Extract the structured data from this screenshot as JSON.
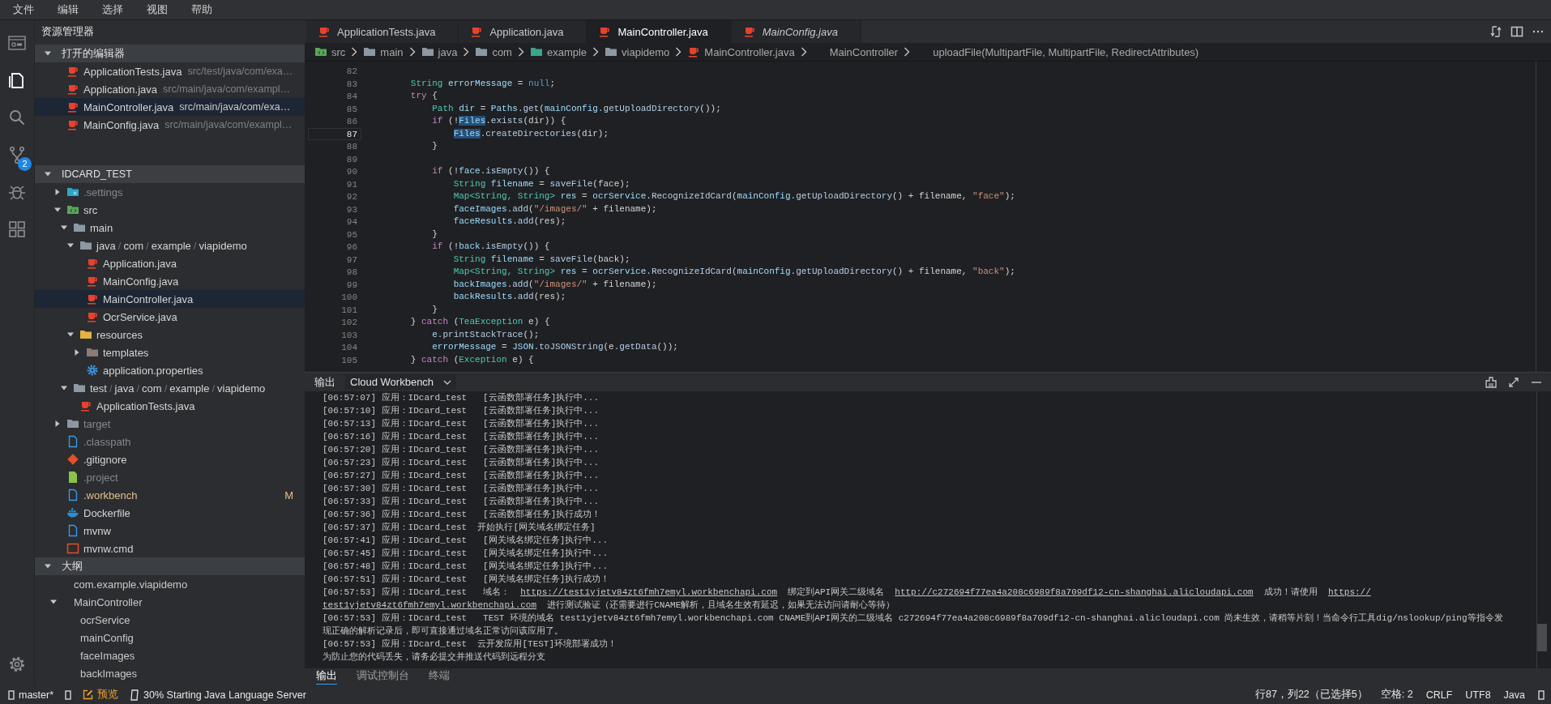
{
  "menu": [
    "文件",
    "编辑",
    "选择",
    "视图",
    "帮助"
  ],
  "activity_bar": {
    "items": [
      {
        "kind": "workbench",
        "selected": false
      },
      {
        "kind": "explorer",
        "selected": true
      },
      {
        "kind": "search",
        "selected": false
      },
      {
        "kind": "source-control",
        "selected": false,
        "badge": "2"
      },
      {
        "kind": "debug",
        "selected": false
      },
      {
        "kind": "extensions",
        "selected": false
      }
    ]
  },
  "sidebar": {
    "title": "资源管理器",
    "open_editors": {
      "title": "打开的编辑器",
      "expanded": true,
      "items": [
        {
          "name": "ApplicationTests.java",
          "path": "src/test/java/com/exa…",
          "selected": false
        },
        {
          "name": "Application.java",
          "path": "src/main/java/com/exampl…",
          "selected": false
        },
        {
          "name": "MainController.java",
          "path": "src/main/java/com/exa…",
          "selected": true
        },
        {
          "name": "MainConfig.java",
          "path": "src/main/java/com/exampl…",
          "selected": false
        }
      ]
    },
    "project": {
      "title": "IDCARD_TEST",
      "expanded": true,
      "tree": [
        {
          "name": ".settings",
          "kind": "folder-settings",
          "expanded": false,
          "selected": false,
          "ignored": true,
          "modified": false
        },
        {
          "name": "src",
          "kind": "folder-src",
          "expanded": true,
          "selected": false,
          "ignored": false,
          "modified": false,
          "children": [
            {
              "name": "main",
              "kind": "folder",
              "expanded": true,
              "selected": false,
              "ignored": false,
              "modified": false,
              "children": [
                {
                  "segments": [
                    "java",
                    "com",
                    "example",
                    "viapidemo"
                  ],
                  "separator": "/",
                  "kind": "folder",
                  "expanded": true,
                  "selected": false,
                  "ignored": false,
                  "modified": false,
                  "children": [
                    {
                      "name": "Application.java",
                      "kind": "java",
                      "selected": false,
                      "ignored": false,
                      "modified": false
                    },
                    {
                      "name": "MainConfig.java",
                      "kind": "java",
                      "selected": false,
                      "ignored": false,
                      "modified": false
                    },
                    {
                      "name": "MainController.java",
                      "kind": "java",
                      "selected": true,
                      "ignored": false,
                      "modified": false
                    },
                    {
                      "name": "OcrService.java",
                      "kind": "java",
                      "selected": false,
                      "ignored": false,
                      "modified": false
                    }
                  ]
                },
                {
                  "name": "resources",
                  "kind": "folder-resources",
                  "expanded": true,
                  "selected": false,
                  "ignored": false,
                  "modified": false,
                  "children": [
                    {
                      "name": "templates",
                      "kind": "folder-templates",
                      "expanded": false,
                      "selected": false,
                      "ignored": false,
                      "modified": false
                    },
                    {
                      "name": "application.properties",
                      "kind": "properties",
                      "selected": false,
                      "ignored": false,
                      "modified": false
                    }
                  ]
                }
              ]
            },
            {
              "segments": [
                "test",
                "java",
                "com",
                "example",
                "viapidemo"
              ],
              "separator": "/",
              "kind": "folder",
              "expanded": true,
              "selected": false,
              "ignored": false,
              "modified": false,
              "children": [
                {
                  "name": "ApplicationTests.java",
                  "kind": "java",
                  "selected": false,
                  "ignored": false,
                  "modified": false
                }
              ]
            }
          ]
        },
        {
          "name": "target",
          "kind": "folder",
          "expanded": false,
          "selected": false,
          "ignored": true,
          "modified": false
        },
        {
          "name": ".classpath",
          "kind": "file",
          "selected": false,
          "ignored": true,
          "modified": false
        },
        {
          "name": ".gitignore",
          "kind": "git",
          "selected": false,
          "ignored": false,
          "modified": false
        },
        {
          "name": ".project",
          "kind": "project",
          "selected": false,
          "ignored": true,
          "modified": false
        },
        {
          "name": ".workbench",
          "kind": "file",
          "selected": false,
          "ignored": false,
          "modified": true,
          "badge": "M"
        },
        {
          "name": "Dockerfile",
          "kind": "docker",
          "selected": false,
          "ignored": false,
          "modified": false
        },
        {
          "name": "mvnw",
          "kind": "file",
          "selected": false,
          "ignored": false,
          "modified": false
        },
        {
          "name": "mvnw.cmd",
          "kind": "cmd",
          "selected": false,
          "ignored": false,
          "modified": false
        }
      ]
    },
    "outline": {
      "title": "大纲",
      "expanded": true,
      "items": [
        {
          "name": "com.example.viapidemo"
        },
        {
          "name": "MainController",
          "expanded": true,
          "children": [
            {
              "name": "ocrService"
            },
            {
              "name": "mainConfig"
            },
            {
              "name": "faceImages"
            },
            {
              "name": "backImages"
            }
          ]
        }
      ]
    }
  },
  "editor": {
    "tabs": [
      {
        "label": "ApplicationTests.java",
        "selected": false,
        "preview": false
      },
      {
        "label": "Application.java",
        "selected": false,
        "preview": false
      },
      {
        "label": "MainController.java",
        "selected": true,
        "preview": false
      },
      {
        "label": "MainConfig.java",
        "selected": false,
        "preview": true
      }
    ],
    "breadcrumb": [
      {
        "label": "src",
        "kind": "folder-src"
      },
      {
        "label": "main",
        "kind": "folder"
      },
      {
        "label": "java",
        "kind": "folder"
      },
      {
        "label": "com",
        "kind": "folder"
      },
      {
        "label": "example",
        "kind": "package"
      },
      {
        "label": "viapidemo",
        "kind": "folder"
      },
      {
        "label": "MainController.java",
        "kind": "java"
      },
      {
        "label": "MainController",
        "kind": "none"
      },
      {
        "label": "uploadFile(MultipartFile, MultipartFile, RedirectAttributes)",
        "kind": "none"
      }
    ],
    "lines": [
      {
        "number": "82",
        "current": false
      },
      {
        "number": "83",
        "current": false,
        "tokens": [
          {
            "text": "        String",
            "kind": "ty"
          },
          {
            "text": " errorMessage",
            "kind": "v"
          },
          {
            "text": " = ",
            "kind": "p"
          },
          {
            "text": "null",
            "kind": "c"
          },
          {
            "text": ";",
            "kind": "p"
          }
        ]
      },
      {
        "number": "84",
        "current": false,
        "tokens": [
          {
            "text": "        try",
            "kind": "kw"
          },
          {
            "text": " {",
            "kind": "p"
          }
        ]
      },
      {
        "number": "85",
        "current": false,
        "tokens": [
          {
            "text": "            Path",
            "kind": "ty"
          },
          {
            "text": " dir",
            "kind": "v"
          },
          {
            "text": " = ",
            "kind": "p"
          },
          {
            "text": "Paths",
            "kind": "v"
          },
          {
            "text": ".",
            "kind": "p"
          },
          {
            "text": "get",
            "kind": "fn"
          },
          {
            "text": "(",
            "kind": "p"
          },
          {
            "text": "mainConfig",
            "kind": "v"
          },
          {
            "text": ".",
            "kind": "p"
          },
          {
            "text": "getUploadDirectory",
            "kind": "fn"
          },
          {
            "text": "());",
            "kind": "p"
          }
        ]
      },
      {
        "number": "86",
        "current": false,
        "tokens": [
          {
            "text": "            if",
            "kind": "kw"
          },
          {
            "text": " (!",
            "kind": "p"
          },
          {
            "text": "Files",
            "kind": "m"
          },
          {
            "text": ".",
            "kind": "p"
          },
          {
            "text": "exists",
            "kind": "fn"
          },
          {
            "text": "(dir)) {",
            "kind": "p"
          }
        ]
      },
      {
        "number": "87",
        "current": true,
        "tokens": [
          {
            "text": "                Files",
            "kind": "m"
          },
          {
            "text": ".",
            "kind": "p"
          },
          {
            "text": "createDirectories",
            "kind": "fn"
          },
          {
            "text": "(dir);",
            "kind": "p"
          }
        ]
      },
      {
        "number": "88",
        "current": false,
        "tokens": [
          {
            "text": "            }",
            "kind": "p"
          }
        ]
      },
      {
        "number": "89",
        "current": false
      },
      {
        "number": "90",
        "current": false,
        "tokens": [
          {
            "text": "            if",
            "kind": "kw"
          },
          {
            "text": " (!",
            "kind": "p"
          },
          {
            "text": "face",
            "kind": "v"
          },
          {
            "text": ".",
            "kind": "p"
          },
          {
            "text": "isEmpty",
            "kind": "fn"
          },
          {
            "text": "()) {",
            "kind": "p"
          }
        ]
      },
      {
        "number": "91",
        "current": false,
        "tokens": [
          {
            "text": "                String",
            "kind": "ty"
          },
          {
            "text": " filename",
            "kind": "v"
          },
          {
            "text": " = ",
            "kind": "p"
          },
          {
            "text": "saveFile",
            "kind": "fn"
          },
          {
            "text": "(face);",
            "kind": "p"
          }
        ]
      },
      {
        "number": "92",
        "current": false,
        "tokens": [
          {
            "text": "                Map<String, String>",
            "kind": "ty"
          },
          {
            "text": " res",
            "kind": "v"
          },
          {
            "text": " = ",
            "kind": "p"
          },
          {
            "text": "ocrService",
            "kind": "v"
          },
          {
            "text": ".",
            "kind": "p"
          },
          {
            "text": "RecognizeIdCard",
            "kind": "fn"
          },
          {
            "text": "(",
            "kind": "p"
          },
          {
            "text": "mainConfig",
            "kind": "v"
          },
          {
            "text": ".",
            "kind": "p"
          },
          {
            "text": "getUploadDirectory",
            "kind": "fn"
          },
          {
            "text": "() + filename, ",
            "kind": "p"
          },
          {
            "text": "\"face\"",
            "kind": "s"
          },
          {
            "text": ");",
            "kind": "p"
          }
        ]
      },
      {
        "number": "93",
        "current": false,
        "tokens": [
          {
            "text": "                faceImages",
            "kind": "v"
          },
          {
            "text": ".",
            "kind": "p"
          },
          {
            "text": "add",
            "kind": "fn"
          },
          {
            "text": "(",
            "kind": "p"
          },
          {
            "text": "\"/images/\"",
            "kind": "s"
          },
          {
            "text": " + filename);",
            "kind": "p"
          }
        ]
      },
      {
        "number": "94",
        "current": false,
        "tokens": [
          {
            "text": "                faceResults",
            "kind": "v"
          },
          {
            "text": ".",
            "kind": "p"
          },
          {
            "text": "add",
            "kind": "fn"
          },
          {
            "text": "(res);",
            "kind": "p"
          }
        ]
      },
      {
        "number": "95",
        "current": false,
        "tokens": [
          {
            "text": "            }",
            "kind": "p"
          }
        ]
      },
      {
        "number": "96",
        "current": false,
        "tokens": [
          {
            "text": "            if",
            "kind": "kw"
          },
          {
            "text": " (!",
            "kind": "p"
          },
          {
            "text": "back",
            "kind": "v"
          },
          {
            "text": ".",
            "kind": "p"
          },
          {
            "text": "isEmpty",
            "kind": "fn"
          },
          {
            "text": "()) {",
            "kind": "p"
          }
        ]
      },
      {
        "number": "97",
        "current": false,
        "tokens": [
          {
            "text": "                String",
            "kind": "ty"
          },
          {
            "text": " filename",
            "kind": "v"
          },
          {
            "text": " = ",
            "kind": "p"
          },
          {
            "text": "saveFile",
            "kind": "fn"
          },
          {
            "text": "(back);",
            "kind": "p"
          }
        ]
      },
      {
        "number": "98",
        "current": false,
        "tokens": [
          {
            "text": "                Map<String, String>",
            "kind": "ty"
          },
          {
            "text": " res",
            "kind": "v"
          },
          {
            "text": " = ",
            "kind": "p"
          },
          {
            "text": "ocrService",
            "kind": "v"
          },
          {
            "text": ".",
            "kind": "p"
          },
          {
            "text": "RecognizeIdCard",
            "kind": "fn"
          },
          {
            "text": "(",
            "kind": "p"
          },
          {
            "text": "mainConfig",
            "kind": "v"
          },
          {
            "text": ".",
            "kind": "p"
          },
          {
            "text": "getUploadDirectory",
            "kind": "fn"
          },
          {
            "text": "() + filename, ",
            "kind": "p"
          },
          {
            "text": "\"back\"",
            "kind": "s"
          },
          {
            "text": ");",
            "kind": "p"
          }
        ]
      },
      {
        "number": "99",
        "current": false,
        "tokens": [
          {
            "text": "                backImages",
            "kind": "v"
          },
          {
            "text": ".",
            "kind": "p"
          },
          {
            "text": "add",
            "kind": "fn"
          },
          {
            "text": "(",
            "kind": "p"
          },
          {
            "text": "\"/images/\"",
            "kind": "s"
          },
          {
            "text": " + filename);",
            "kind": "p"
          }
        ]
      },
      {
        "number": "100",
        "current": false,
        "tokens": [
          {
            "text": "                backResults",
            "kind": "v"
          },
          {
            "text": ".",
            "kind": "p"
          },
          {
            "text": "add",
            "kind": "fn"
          },
          {
            "text": "(res);",
            "kind": "p"
          }
        ]
      },
      {
        "number": "101",
        "current": false,
        "tokens": [
          {
            "text": "            }",
            "kind": "p"
          }
        ]
      },
      {
        "number": "102",
        "current": false,
        "tokens": [
          {
            "text": "        } ",
            "kind": "p"
          },
          {
            "text": "catch",
            "kind": "kw"
          },
          {
            "text": " (",
            "kind": "p"
          },
          {
            "text": "TeaException",
            "kind": "ty"
          },
          {
            "text": " e) {",
            "kind": "p"
          }
        ]
      },
      {
        "number": "103",
        "current": false,
        "tokens": [
          {
            "text": "            e",
            "kind": "v"
          },
          {
            "text": ".",
            "kind": "p"
          },
          {
            "text": "printStackTrace",
            "kind": "fn"
          },
          {
            "text": "();",
            "kind": "p"
          }
        ]
      },
      {
        "number": "104",
        "current": false,
        "tokens": [
          {
            "text": "            errorMessage",
            "kind": "v"
          },
          {
            "text": " = ",
            "kind": "p"
          },
          {
            "text": "JSON",
            "kind": "v"
          },
          {
            "text": ".",
            "kind": "p"
          },
          {
            "text": "toJSONString",
            "kind": "fn"
          },
          {
            "text": "(e.",
            "kind": "p"
          },
          {
            "text": "getData",
            "kind": "fn"
          },
          {
            "text": "());",
            "kind": "p"
          }
        ]
      },
      {
        "number": "105",
        "current": false,
        "tokens": [
          {
            "text": "        } ",
            "kind": "p"
          },
          {
            "text": "catch",
            "kind": "kw"
          },
          {
            "text": " (",
            "kind": "p"
          },
          {
            "text": "Exception",
            "kind": "ty"
          },
          {
            "text": " e) {",
            "kind": "p"
          }
        ]
      }
    ]
  },
  "panel": {
    "title": "输出",
    "channel": "Cloud Workbench",
    "log": [
      {
        "text": "[06:57:07] 应用：IDcard_test   [云函数部署任务]执行中..."
      },
      {
        "text": "[06:57:10] 应用：IDcard_test   [云函数部署任务]执行中..."
      },
      {
        "text": "[06:57:13] 应用：IDcard_test   [云函数部署任务]执行中..."
      },
      {
        "text": "[06:57:16] 应用：IDcard_test   [云函数部署任务]执行中..."
      },
      {
        "text": "[06:57:20] 应用：IDcard_test   [云函数部署任务]执行中..."
      },
      {
        "text": "[06:57:23] 应用：IDcard_test   [云函数部署任务]执行中..."
      },
      {
        "text": "[06:57:27] 应用：IDcard_test   [云函数部署任务]执行中..."
      },
      {
        "text": "[06:57:30] 应用：IDcard_test   [云函数部署任务]执行中..."
      },
      {
        "text": "[06:57:33] 应用：IDcard_test   [云函数部署任务]执行中..."
      },
      {
        "text": "[06:57:36] 应用：IDcard_test   [云函数部署任务]执行成功！"
      },
      {
        "text": "[06:57:37] 应用：IDcard_test  开始执行[网关域名绑定任务]"
      },
      {
        "text": "[06:57:41] 应用：IDcard_test   [网关域名绑定任务]执行中..."
      },
      {
        "text": "[06:57:45] 应用：IDcard_test   [网关域名绑定任务]执行中..."
      },
      {
        "text": "[06:57:48] 应用：IDcard_test   [网关域名绑定任务]执行中..."
      },
      {
        "text": "[06:57:51] 应用：IDcard_test   [网关域名绑定任务]执行成功！"
      },
      {
        "segments": [
          {
            "text": "[06:57:53] 应用：IDcard_test   域名：  ",
            "link": false
          },
          {
            "text": "https://test1yjetv84zt6fmh7emyl.workbenchapi.com",
            "link": true
          },
          {
            "text": "  绑定到API网关二级域名  ",
            "link": false
          },
          {
            "text": "http://c272694f77ea4a208c6989f8a709df12-cn-shanghai.alicloudapi.com",
            "link": true
          },
          {
            "text": "  成功！请使用  ",
            "link": false
          },
          {
            "text": "https://",
            "link": true
          }
        ]
      },
      {
        "segments": [
          {
            "text": "test1yjetv84zt6fmh7emyl.workbenchapi.com",
            "link": true
          },
          {
            "text": "  进行测试验证（还需要进行CNAME解析，且域名生效有延迟，如果无法访问请耐心等待）",
            "link": false
          }
        ]
      },
      {
        "text": "[06:57:53] 应用：IDcard_test   TEST 环境的域名 test1yjetv84zt6fmh7emyl.workbenchapi.com CNAME到API网关的二级域名 c272694f77ea4a208c6989f8a709df12-cn-shanghai.alicloudapi.com 尚未生效，请稍等片刻！当命令行工具dig/nslookup/ping等指令发"
      },
      {
        "text": "现正确的解析记录后，即可直接通过域名正常访问该应用了。"
      },
      {
        "text": "[06:57:53] 应用：IDcard_test  云开发应用[TEST]环境部署成功！"
      },
      {
        "text": "为防止您的代码丢失，请务必提交并推送代码到远程分支"
      }
    ],
    "tabs": [
      {
        "label": "输出",
        "selected": true
      },
      {
        "label": "调试控制台",
        "selected": false
      },
      {
        "label": "终端",
        "selected": false
      }
    ]
  },
  "status_bar": {
    "left": [
      {
        "kind": "branch",
        "text": "master*"
      },
      {
        "kind": "sync"
      },
      {
        "kind": "preview",
        "text": "预览"
      },
      {
        "kind": "progress",
        "text": "30% Starting Java Language Server"
      }
    ],
    "right": [
      {
        "kind": "text",
        "text": "行87，列22（已选择5）"
      },
      {
        "kind": "text",
        "text": "空格: 2"
      },
      {
        "kind": "text",
        "text": "CRLF"
      },
      {
        "kind": "text",
        "text": "UTF8"
      },
      {
        "kind": "text",
        "text": "Java"
      },
      {
        "kind": "feedback"
      }
    ]
  }
}
